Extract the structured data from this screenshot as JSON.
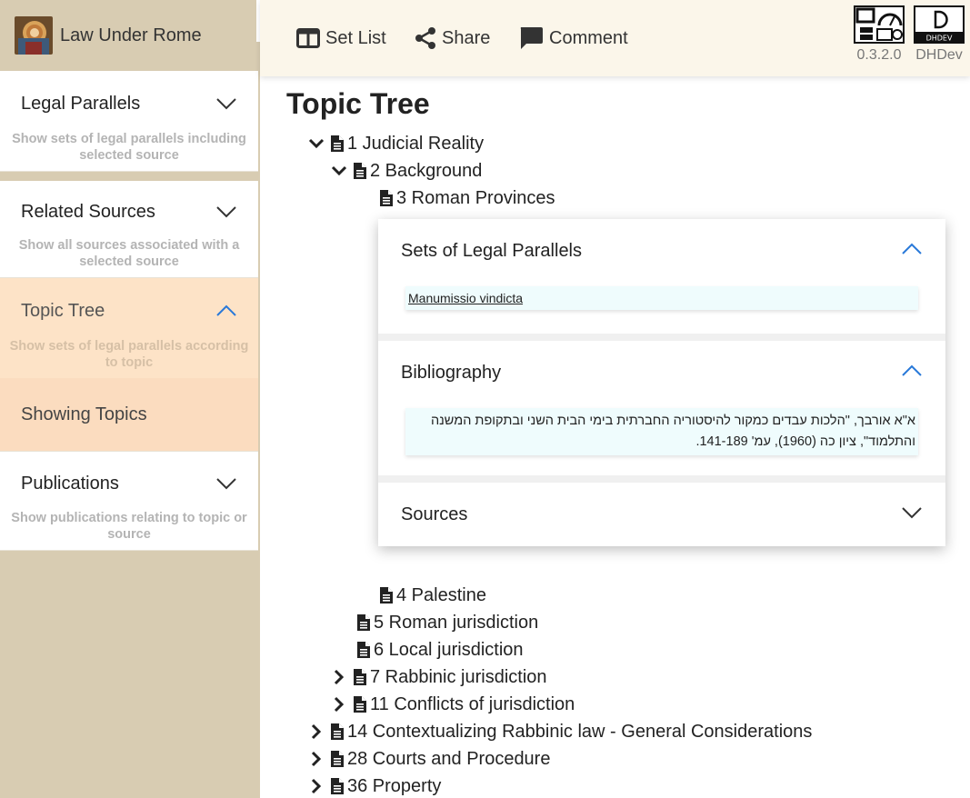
{
  "app": {
    "title": "Law Under Rome"
  },
  "sidebar": {
    "items": [
      {
        "label": "Legal Parallels",
        "description": "Show sets of legal parallels including selected source"
      },
      {
        "label": "Related Sources",
        "description": "Show all sources associated with a selected source"
      },
      {
        "label": "Topic Tree",
        "description": "Show sets of legal parallels according to topic",
        "sub_label": "Showing Topics"
      },
      {
        "label": "Publications",
        "description": "Show publications relating to topic or source"
      }
    ]
  },
  "toolbar": {
    "set_list": "Set List",
    "share": "Share",
    "comment": "Comment"
  },
  "badges": {
    "version": "0.3.2.0",
    "dhdev": "DHDev",
    "dhdev_logo_text": "DHDEV"
  },
  "main": {
    "title": "Topic Tree",
    "tree": [
      {
        "label": "1 Judicial Reality",
        "toggle": "expanded"
      },
      {
        "label": "2 Background",
        "toggle": "expanded"
      },
      {
        "label": "3 Roman Provinces",
        "toggle": "none"
      },
      {
        "label": "4 Palestine",
        "toggle": "none"
      },
      {
        "label": "5 Roman jurisdiction",
        "toggle": "none"
      },
      {
        "label": "6 Local jurisdiction",
        "toggle": "none"
      },
      {
        "label": "7 Rabbinic jurisdiction",
        "toggle": "collapsed"
      },
      {
        "label": "11 Conflicts of jurisdiction",
        "toggle": "collapsed"
      },
      {
        "label": "14 Contextualizing Rabbinic law - General Considerations",
        "toggle": "collapsed"
      },
      {
        "label": "28 Courts and Procedure",
        "toggle": "collapsed"
      },
      {
        "label": "36 Property",
        "toggle": "collapsed"
      }
    ],
    "detail": {
      "legal_parallels": {
        "title": "Sets of Legal Parallels",
        "entries": [
          "Manumissio vindicta"
        ]
      },
      "bibliography": {
        "title": "Bibliography",
        "entries": [
          "א\"א אורבך, \"הלכות עבדים כמקור להיסטוריה החברתית בימי הבית השני ובתקופת המשנה והתלמוד\", ציון כה (1960), עמ' 141-189."
        ]
      },
      "sources": {
        "title": "Sources"
      }
    }
  },
  "colors": {
    "sidebar_bg": "#d8ccb2",
    "topbar_bg": "#fbf6ea",
    "active_bg": "#fde3c7",
    "accent_chevron": "#2979d9",
    "entry_bg": "#effcfd"
  }
}
